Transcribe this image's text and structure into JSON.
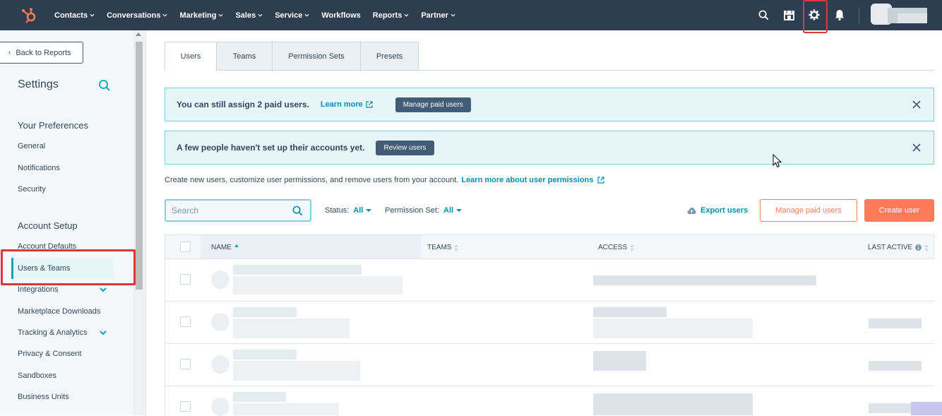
{
  "topnav": {
    "items": [
      "Contacts",
      "Conversations",
      "Marketing",
      "Sales",
      "Service",
      "Workflows",
      "Reports",
      "Partner"
    ],
    "has_chevron": [
      true,
      true,
      true,
      true,
      true,
      false,
      true,
      true
    ],
    "icons": [
      "search-icon",
      "marketplace-icon",
      "gear-icon",
      "bell-icon"
    ],
    "brand_color": "#2d3e50",
    "logo_color": "#ff7a59"
  },
  "sidebar": {
    "back_label": "Back to Reports",
    "title": "Settings",
    "sections": [
      {
        "title": "Your Preferences",
        "items": [
          "General",
          "Notifications",
          "Security"
        ]
      },
      {
        "title": "Account Setup",
        "items": [
          "Account Defaults",
          "Users & Teams",
          "Integrations",
          "Marketplace Downloads",
          "Tracking & Analytics",
          "Privacy & Consent",
          "Sandboxes",
          "Business Units"
        ]
      }
    ],
    "active_item": "Users & Teams"
  },
  "main": {
    "tabs": [
      "Users",
      "Teams",
      "Permission Sets",
      "Presets"
    ],
    "active_tab": "Users",
    "banner1": {
      "text": "You can still assign 2 paid users.",
      "link": "Learn more",
      "button": "Manage paid users"
    },
    "banner2": {
      "text": "A few people haven't set up their accounts yet.",
      "button": "Review users"
    },
    "description": "Create new users, customize user permissions, and remove users from your account.",
    "description_link": "Learn more about user permissions",
    "search_placeholder": "Search",
    "filters": [
      {
        "label": "Status:",
        "value": "All"
      },
      {
        "label": "Permission Set:",
        "value": "All"
      }
    ],
    "export_label": "Export users",
    "manage_paid_label": "Manage paid users",
    "create_user_label": "Create user",
    "table": {
      "columns": [
        "NAME",
        "TEAMS",
        "ACCESS",
        "LAST ACTIVE"
      ]
    }
  },
  "colors": {
    "accent": "#0091ae",
    "banner_bg": "#e5f5f8",
    "cta": "#ff7a59",
    "highlight_box": "#e0343e"
  }
}
